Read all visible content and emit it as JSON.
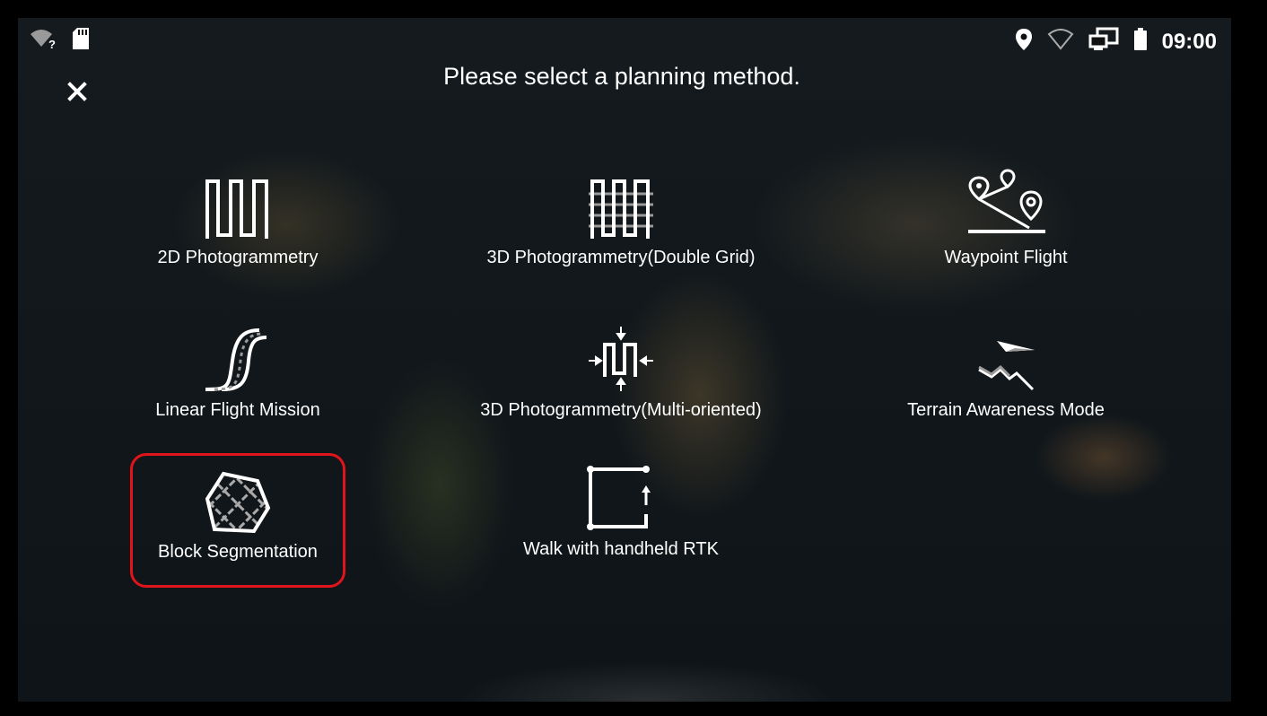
{
  "status_bar": {
    "time": "09:00",
    "left_icons": [
      "wifi-unknown-icon",
      "sd-card-icon"
    ],
    "right_icons": [
      "location-icon",
      "wifi-icon",
      "screen-cast-icon",
      "battery-icon"
    ]
  },
  "dialog": {
    "title": "Please select a planning method.",
    "close_icon": "close-icon"
  },
  "options": [
    {
      "label": "2D Photogrammetry",
      "icon": "2d-photogrammetry-icon",
      "selected": false
    },
    {
      "label": "3D Photogrammetry(Double Grid)",
      "icon": "double-grid-icon",
      "selected": false
    },
    {
      "label": "Waypoint Flight",
      "icon": "waypoint-icon",
      "selected": false
    },
    {
      "label": "Linear Flight Mission",
      "icon": "linear-flight-icon",
      "selected": false
    },
    {
      "label": "3D Photogrammetry(Multi-oriented)",
      "icon": "multi-oriented-icon",
      "selected": false
    },
    {
      "label": "Terrain Awareness Mode",
      "icon": "terrain-awareness-icon",
      "selected": false
    },
    {
      "label": "Block Segmentation",
      "icon": "block-segmentation-icon",
      "selected": true
    },
    {
      "label": "Walk with handheld RTK",
      "icon": "handheld-rtk-icon",
      "selected": false
    }
  ],
  "colors": {
    "selection_border": "#e0141b",
    "text": "#ffffff"
  }
}
